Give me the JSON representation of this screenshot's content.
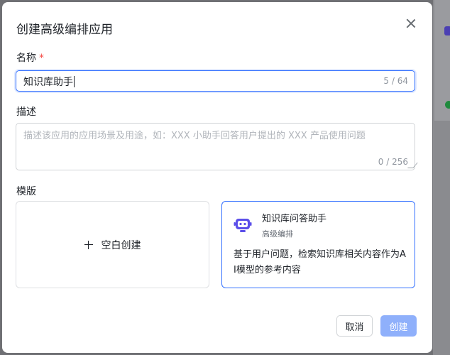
{
  "dialog": {
    "title": "创建高级编排应用"
  },
  "name_field": {
    "label": "名称",
    "required_mark": "*",
    "value": "知识库助手",
    "counter": "5 / 64"
  },
  "description_field": {
    "label": "描述",
    "placeholder": "描述该应用的应用场景及用途，如：XXX 小助手回答用户提出的 XXX 产品使用问题",
    "counter": "0 / 256"
  },
  "template_section": {
    "label": "模版",
    "blank_card": {
      "label": "空白创建",
      "icon": "plus-icon"
    },
    "kb_card": {
      "title": "知识库问答助手",
      "subtitle": "高级编排",
      "description": "基于用户问题，检索知识库相关内容作为AI模型的参考内容",
      "icon": "robot-icon",
      "accent": "#5b4fe9"
    }
  },
  "actions": {
    "cancel": "取消",
    "create": "创建"
  },
  "colors": {
    "primary": "#3370ff",
    "primary_disabled": "#8fb0fb",
    "danger": "#f54a45"
  }
}
